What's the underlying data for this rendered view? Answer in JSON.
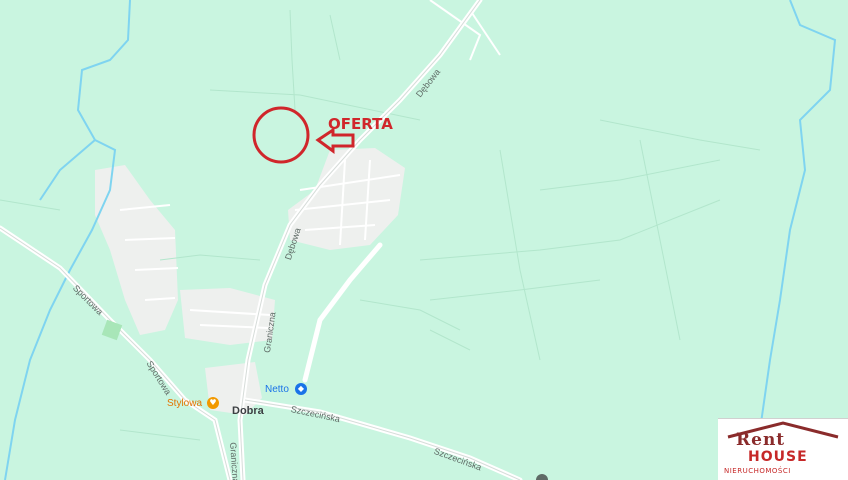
{
  "map": {
    "annotation": {
      "label": "OFERTA"
    },
    "streets": {
      "debowa_1": "Dębowa",
      "debowa_2": "Dębowa",
      "graniczna_1": "Graniczna",
      "graniczna_2": "Graniczna",
      "sportowa_1": "Sportowa",
      "sportowa_2": "Sportowa",
      "szczecinska_1": "Szczecińska",
      "szczecinska_2": "Szczecińska"
    },
    "places": {
      "town": "Dobra",
      "shop": "Netto",
      "restaurant": "Stylowa"
    },
    "icons": {
      "shop": "shopping-bag-icon",
      "restaurant": "fork-knife-icon"
    },
    "colors": {
      "land": "#c9f5e0",
      "builtup": "#eef0ee",
      "road": "#ffffff",
      "water": "#7fd4f0",
      "annotation": "#d0262b",
      "shop_pin": "#1a73e8",
      "restaurant_pin": "#f29900"
    }
  },
  "watermark": {
    "line1": "Rent",
    "line2": "HOUSE",
    "line3": "NIERUCHOMOŚCI"
  }
}
